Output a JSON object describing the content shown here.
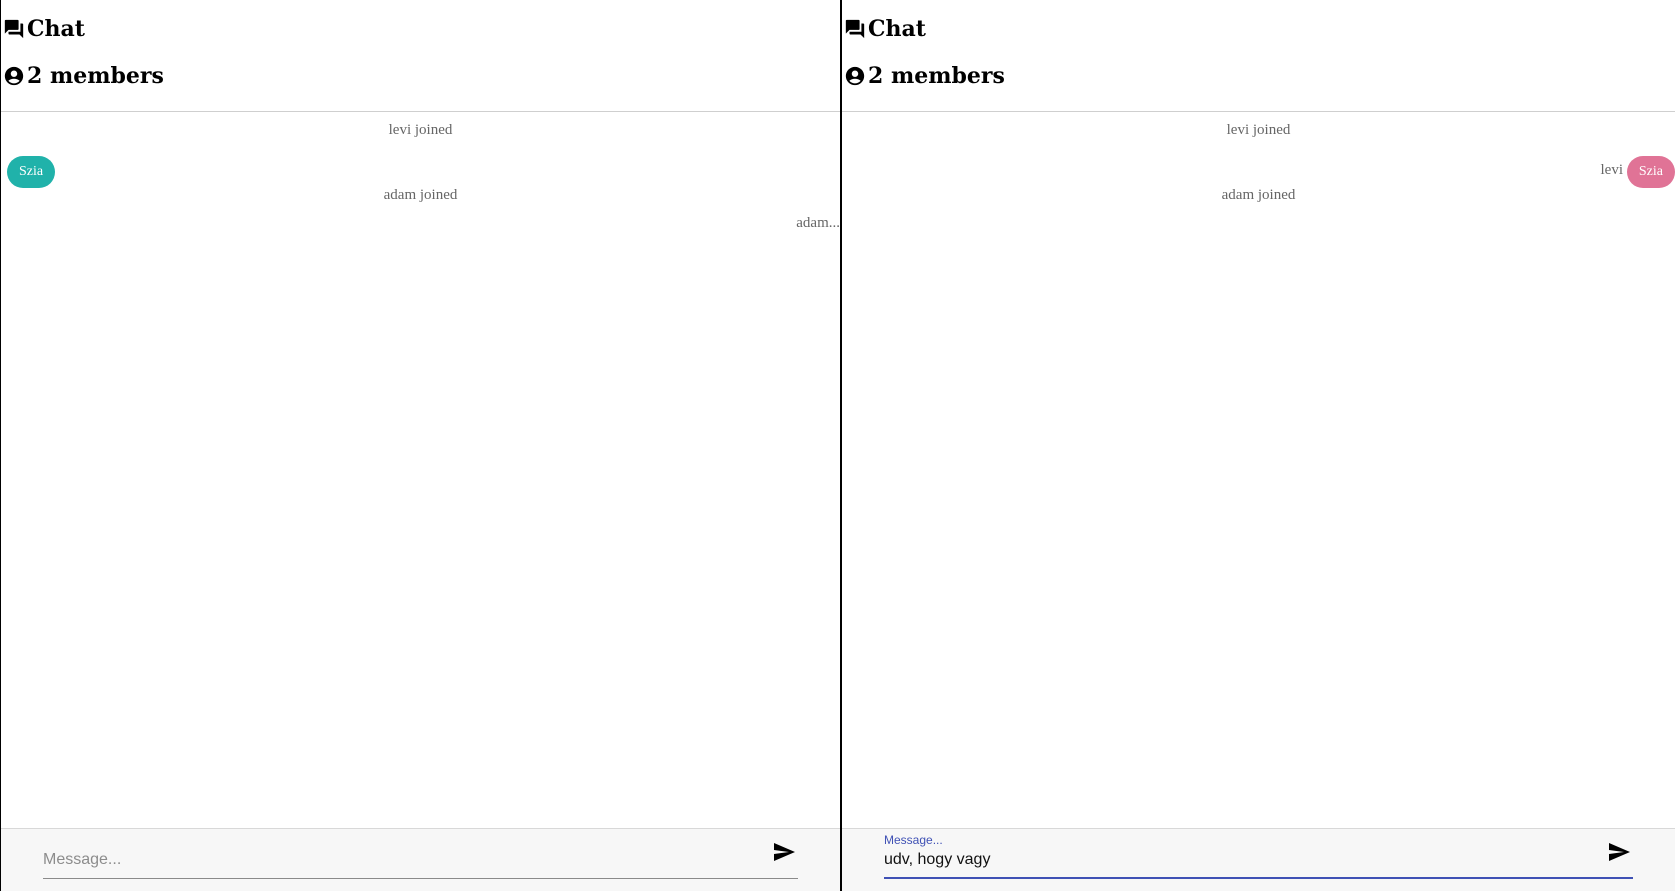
{
  "left_pane": {
    "header": {
      "title_icon": "forum-icon",
      "title": "Chat",
      "members_icon": "account-circle-icon",
      "members": "2 members"
    },
    "messages": {
      "system_1": "levi joined",
      "bubble_text": "Szia",
      "system_2": "adam joined",
      "typing": "adam..."
    },
    "composer": {
      "placeholder": "Message...",
      "value": "",
      "send_icon": "send-icon"
    }
  },
  "right_pane": {
    "header": {
      "title_icon": "forum-icon",
      "title": "Chat",
      "members_icon": "account-circle-icon",
      "members": "2 members"
    },
    "messages": {
      "system_1": "levi joined",
      "sender": "levi",
      "bubble_text": "Szia",
      "system_2": "adam joined"
    },
    "composer": {
      "label": "Message...",
      "value": "udv, hogy vagy",
      "send_icon": "send-icon"
    }
  },
  "colors": {
    "own_bubble": "#20b2aa",
    "other_bubble": "#e07396",
    "focus_accent": "#3f51b5"
  }
}
